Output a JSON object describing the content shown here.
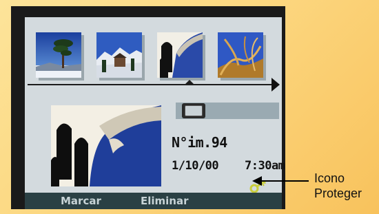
{
  "thumbnails": [
    {
      "icon": "pine-tree-photo"
    },
    {
      "icon": "mountain-cabin-photo"
    },
    {
      "icon": "arched-building-photo"
    },
    {
      "icon": "twisted-branches-photo"
    }
  ],
  "preview": {
    "icon": "arched-building-photo"
  },
  "scroll_position": 0.05,
  "info": {
    "image_number": "N°im.94",
    "date": "1/10/00",
    "time": "7:30am"
  },
  "protect_icon": {
    "icon": "key-icon",
    "color": "#c8cc3a"
  },
  "menu": {
    "mark_label": "Marcar",
    "delete_label": "Eliminar"
  },
  "callout": {
    "line1": "Icono",
    "line2": "Proteger"
  },
  "colors": {
    "background": "#fcd780",
    "screen": "#d3dade",
    "menubar": "#2a4044",
    "menu_text": "#c7d3d6"
  }
}
